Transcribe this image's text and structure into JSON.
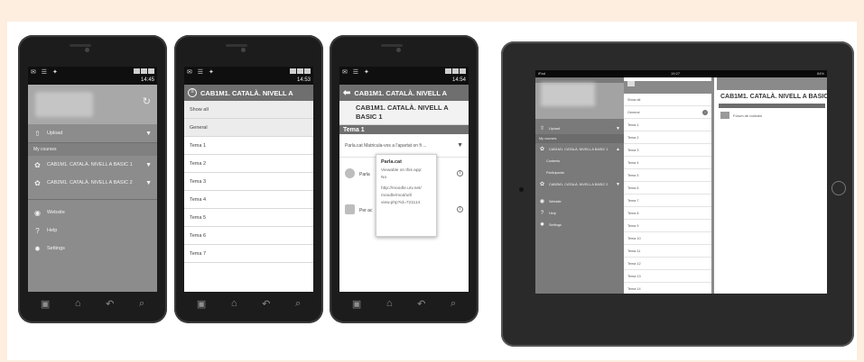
{
  "phone1": {
    "status_time": "14:45",
    "menu": {
      "upload": "Upload",
      "my_courses_label": "My courses",
      "courses": [
        "CAB1M1. CATALÀ. NIVELL A BASIC 1",
        "CAB2M1. CATALÀ. NIVELL A BASIC 2"
      ],
      "website": "Website",
      "help": "Help",
      "settings": "Settings"
    }
  },
  "phone2": {
    "status_time": "14:53",
    "title": "CAB1M1. CATALÀ. NIVELL A",
    "sections": [
      "Show all",
      "General",
      "Tema 1",
      "Tema 2",
      "Tema 3",
      "Tema 4",
      "Tema 5",
      "Tema 6",
      "Tema 7"
    ]
  },
  "phone3": {
    "status_time": "14:54",
    "title": "CAB1M1. CATALÀ. NIVELL A",
    "course_title": "CAB1M1. CATALÀ. NIVELL A BASIC 1",
    "topic": "Tema 1",
    "module_line": "Parla.cat Matricula-vos a l'apartat on fi ...",
    "activity1": "Parla",
    "activity2": "Per ac",
    "popup": {
      "title": "Parla.cat",
      "line1": "Viewable on this app:",
      "line2": "No",
      "line3": "http://moodle.urv.net/",
      "line4": "moodle/mod/url/",
      "line5": "view.php?id=721114"
    }
  },
  "tablet": {
    "status_left": "iPad",
    "status_center": "19:27",
    "status_right": "84%",
    "menu": {
      "upload": "Upload",
      "my_courses_label": "My courses",
      "course1": "CAB1M1. CATALÀ. NIVELL A BASIC 1",
      "contents": "Contents",
      "participants": "Participants",
      "course2": "CAB2M1. CATALÀ. NIVELL A BASIC 2",
      "website": "Website",
      "help": "Help",
      "settings": "Settings"
    },
    "sections": [
      "Show all",
      "General",
      "Tema 1",
      "Tema 2",
      "Tema 3",
      "Tema 4",
      "Tema 5",
      "Tema 6",
      "Tema 7",
      "Tema 8",
      "Tema 9",
      "Tema 10",
      "Tema 11",
      "Tema 12",
      "Tema 13",
      "Tema 14"
    ],
    "course_title": "CAB1M1. CATALÀ. NIVELL A BASIC 1",
    "forum": "Fòrum de notícies"
  }
}
